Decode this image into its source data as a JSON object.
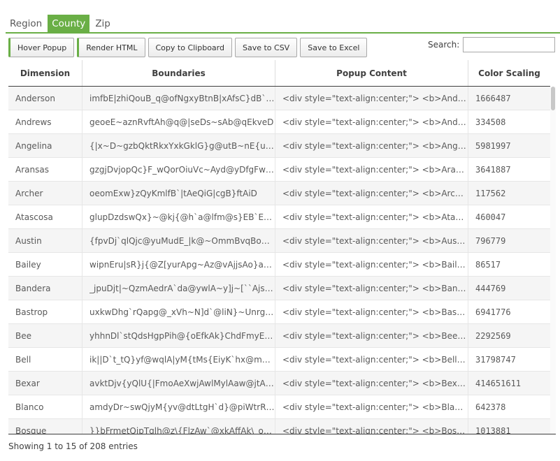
{
  "tabs": [
    {
      "label": "Region",
      "active": false
    },
    {
      "label": "County",
      "active": true
    },
    {
      "label": "Zip",
      "active": false
    }
  ],
  "toolbar": {
    "hover_popup": "Hover Popup",
    "render_html": "Render HTML",
    "copy_clipboard": "Copy to Clipboard",
    "save_csv": "Save to CSV",
    "save_excel": "Save to Excel",
    "search_label": "Search:",
    "search_value": ""
  },
  "table": {
    "columns": [
      "Dimension",
      "Boundaries",
      "Popup Content",
      "Color Scaling"
    ],
    "rows": [
      {
        "dimension": "Anderson",
        "boundaries": "imfbE|zhiQouB_q@ofNgxyBtnB|xAfsC}dB`…",
        "popup": "<div style=\"text-align:center;\"> <b>Anders…",
        "color": "1666487"
      },
      {
        "dimension": "Andrews",
        "boundaries": "geoeE~aznRvftAh@q@|seDs~sAb@qEkveD",
        "popup": "<div style=\"text-align:center;\"> <b>Andre…",
        "color": "334508"
      },
      {
        "dimension": "Angelina",
        "boundaries": "{|x~D~gzbQktRkxYxkGklG}g@utB~nE{uMvf…",
        "popup": "<div style=\"text-align:center;\"> <b>Angelin…",
        "color": "5981997"
      },
      {
        "dimension": "Aransas",
        "boundaries": "gzgjDvjopQc}F_wQorOiuVc~Ayd@yDfgFwl…",
        "popup": "<div style=\"text-align:center;\"> <b>Aransa…",
        "color": "3641887"
      },
      {
        "dimension": "Archer",
        "boundaries": "oeomExw}zQyKmlfB`|tAeQiG|cgB}ftAiD",
        "popup": "<div style=\"text-align:center;\"> <b>Archer…",
        "color": "117562"
      },
      {
        "dimension": "Atascosa",
        "boundaries": "glupDzdswQx}~@kj{@h`a@lfm@s}EB`Ef~y…",
        "popup": "<div style=\"text-align:center;\"> <b>Atasco…",
        "color": "460047"
      },
      {
        "dimension": "Austin",
        "boundaries": "{fpvDj`qlQjc@yuMudE_|k@~OmmBvqBoh…",
        "popup": "<div style=\"text-align:center;\"> <b>Austin…",
        "color": "796779"
      },
      {
        "dimension": "Bailey",
        "boundaries": "wipnEru|sR}j{@Z[yurApg~Az@vAjjsAo}a@iV",
        "popup": "<div style=\"text-align:center;\"> <b>Bailey<…",
        "color": "86517"
      },
      {
        "dimension": "Bandera",
        "boundaries": "_jpuDjt|~QzmAedrA`da@ywlA~y]j~[``AjsG…",
        "popup": "<div style=\"text-align:center;\"> <b>Bander…",
        "color": "444769"
      },
      {
        "dimension": "Bastrop",
        "boundaries": "uxkwDhg`rQapg@_xVh~N]d`@liN}~Unrg@…",
        "popup": "<div style=\"text-align:center;\"> <b>Bastro…",
        "color": "6941776"
      },
      {
        "dimension": "Bee",
        "boundaries": "yhhnDl`stQdsHgpPih@{oEfkAk}ChdFmyEv…",
        "popup": "<div style=\"text-align:center;\"> <b>Bee</b…",
        "color": "2292569"
      },
      {
        "dimension": "Bell",
        "boundaries": "ik||D`t_tQ}yf@wqlA|yM{tMs{EiyK`hx@mpg…",
        "popup": "<div style=\"text-align:center;\"> <b>Bell</b…",
        "color": "31798747"
      },
      {
        "dimension": "Bexar",
        "boundaries": "avktDjv{yQlU{|FmoAeXwjAwlMylAaw@jtAk…",
        "popup": "<div style=\"text-align:center;\"> <b>Bexar<…",
        "color": "414651611"
      },
      {
        "dimension": "Blanco",
        "boundaries": "amdyDr~swQjyM{yv@dtLtgH`d}@piWtrRr…",
        "popup": "<div style=\"text-align:center;\"> <b>Blanco…",
        "color": "642378"
      },
      {
        "dimension": "Bosque",
        "boundaries": "}}bFrmetQipTqlh@z\\{FlzAw`@xkAffAk\\_o…",
        "popup": "<div style=\"text-align:center;\"> <b>Bosque…",
        "color": "1013881"
      }
    ]
  },
  "footer": {
    "info": "Showing 1 to 15 of 208 entries"
  }
}
